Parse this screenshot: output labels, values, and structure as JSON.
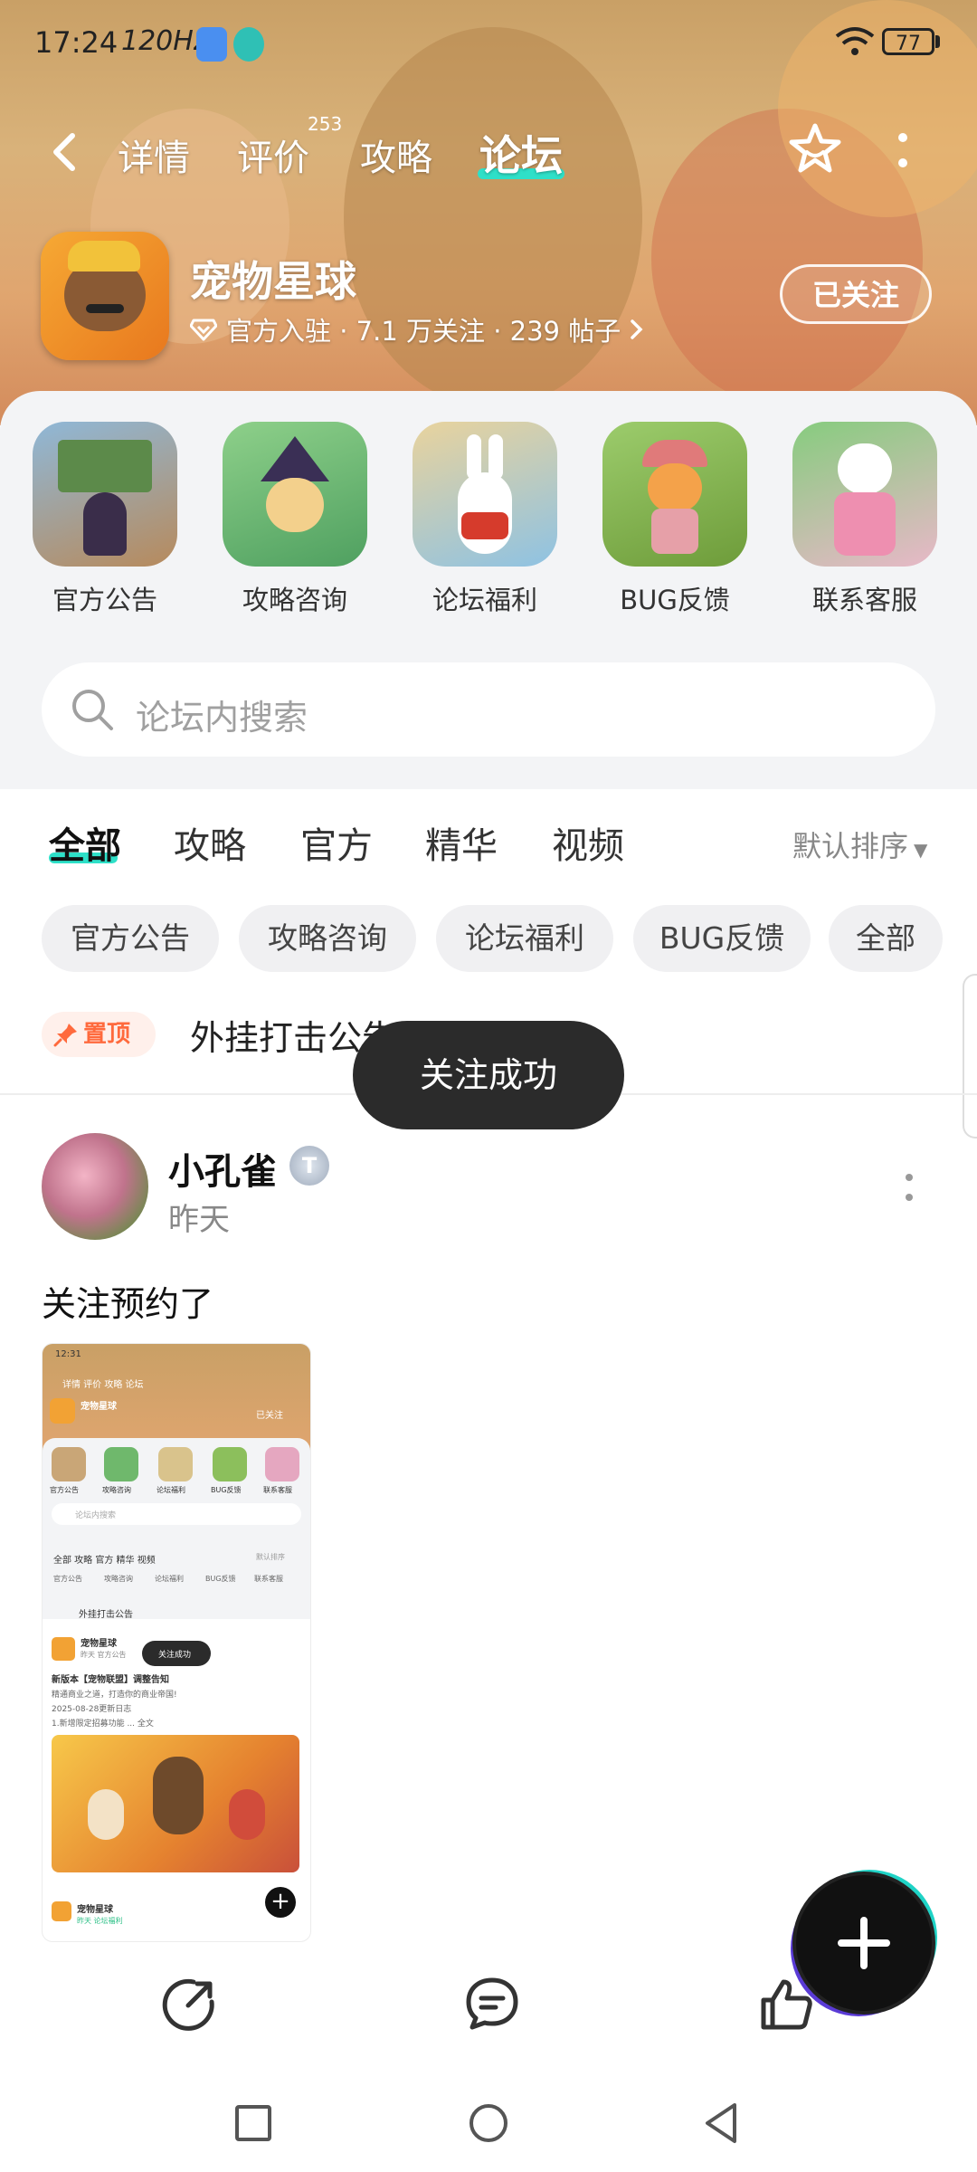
{
  "status_bar": {
    "time": "17:24",
    "refresh": "120Hz",
    "battery": "77"
  },
  "nav": {
    "tabs": [
      {
        "label": "详情",
        "active": false
      },
      {
        "label": "评价",
        "active": false,
        "badge": "253"
      },
      {
        "label": "攻略",
        "active": false
      },
      {
        "label": "论坛",
        "active": true
      }
    ]
  },
  "game": {
    "name": "宠物星球",
    "meta": "官方入驻 · 7.1 万关注 · 239 帖子",
    "follow_label": "已关注"
  },
  "categories": [
    {
      "label": "官方公告"
    },
    {
      "label": "攻略咨询"
    },
    {
      "label": "论坛福利"
    },
    {
      "label": "BUG反馈"
    },
    {
      "label": "联系客服"
    }
  ],
  "search": {
    "placeholder": "论坛内搜索"
  },
  "feed_tabs": {
    "tabs": [
      "全部",
      "攻略",
      "官方",
      "精华",
      "视频"
    ],
    "active": "全部",
    "sort_label": "默认排序"
  },
  "filter_chips": [
    "官方公告",
    "攻略咨询",
    "论坛福利",
    "BUG反馈",
    "全部"
  ],
  "pinned": {
    "tag": "置顶",
    "title": "外挂打击公告"
  },
  "toast": "关注成功",
  "post": {
    "author": "小孔雀",
    "badge": "T",
    "date": "昨天",
    "text": "关注预约了"
  },
  "screenshot_thumb": {
    "time": "12:31",
    "tabs": "详情  评价  攻略  论坛",
    "game_name": "宠物星球",
    "follow": "已关注",
    "cats": [
      "官方公告",
      "攻略咨询",
      "论坛福利",
      "BUG反馈",
      "联系客服"
    ],
    "search": "论坛内搜索",
    "tabs2": "全部   攻略   官方   精华   视频",
    "sort": "默认排序",
    "chips": [
      "官方公告",
      "攻略咨询",
      "论坛福利",
      "BUG反馈",
      "联系客服"
    ],
    "pinned": "外挂打击公告",
    "post_name": "宠物星球",
    "post_meta": "昨天  官方公告",
    "toast": "关注成功",
    "post_title": "新版本【宠物联盟】调整告知",
    "post_line1": "精通商业之道，打造你的商业帝国!",
    "post_line2": "2025-08-28更新日志",
    "post_line3": "1.新增限定招募功能 ... 全文",
    "post2_name": "宠物星球",
    "post2_meta": "昨天  论坛福利"
  },
  "colors": {
    "accent": "#2ee0c8",
    "pin": "#ff6a3d",
    "toast_bg": "#2b2b2b"
  }
}
